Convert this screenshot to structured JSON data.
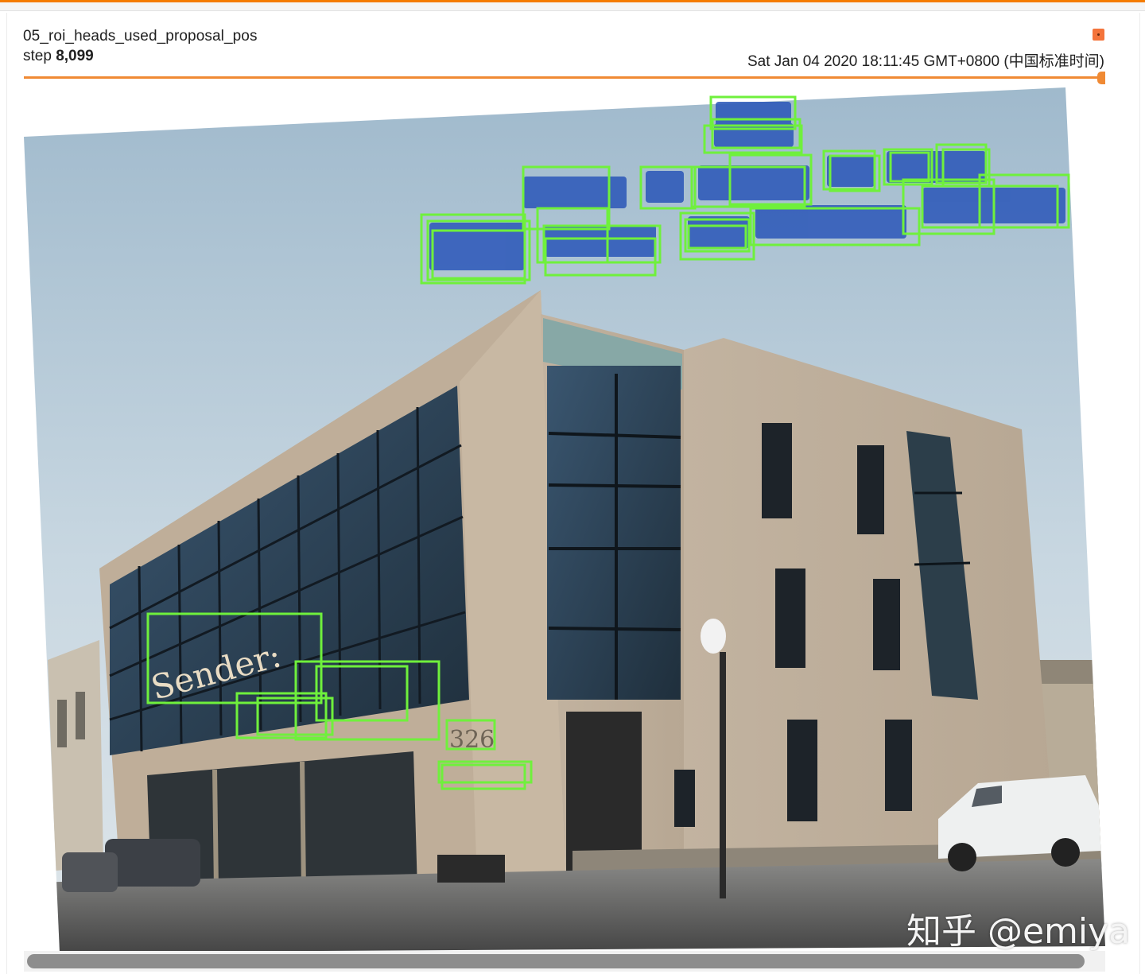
{
  "card": {
    "title": "05_roi_heads_used_proposal_pos",
    "step_label": "step",
    "step_value": "8,099",
    "timestamp": "Sat Jan 04 2020 18:11:45 GMT+0800 (中国标准时间)",
    "expand_icon": "expand-icon"
  },
  "slider": {
    "accent": "#f08a34",
    "position": 1.0
  },
  "image": {
    "sign_text": "Sender:",
    "building_number": "326",
    "box_color": "#6ff03c"
  },
  "watermark": {
    "text": "知乎 @emiya"
  },
  "colors": {
    "accent": "#f57c00",
    "expand": "#f4743b"
  }
}
